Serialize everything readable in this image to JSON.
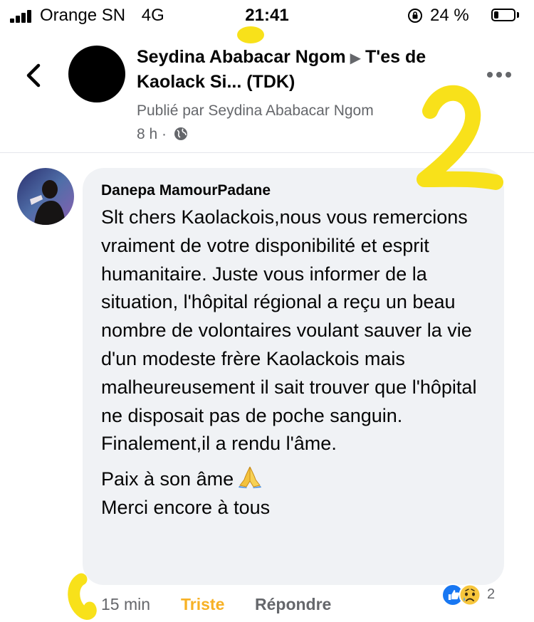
{
  "status_bar": {
    "carrier": "Orange SN",
    "network": "4G",
    "time": "21:41",
    "battery_percent": "24 %",
    "battery_level": 0.24,
    "icons": [
      "signal-icon",
      "orientation-lock-icon",
      "battery-icon"
    ]
  },
  "header": {
    "author": "Seydina Ababacar Ngom",
    "group": "T'es de Kaolack Si... (TDK)",
    "posted_by": "Publié par Seydina Ababacar Ngom",
    "age": "8 h",
    "separator": "·",
    "icons": [
      "back-chevron-icon",
      "arrow-right-icon",
      "globe-icon",
      "more-dots-icon"
    ]
  },
  "comment": {
    "author": "Danepa MamourPadane",
    "paragraphs": [
      "Slt chers Kaolackois,nous vous remercions vraiment de votre disponibilité et esprit humanitaire. Juste vous informer de la situation, l'hôpital régional a reçu un beau nombre de volontaires voulant sauver la vie d'un modeste frère Kaolackois mais malheureusement il sait trouver que l'hôpital ne disposait pas de poche sanguin.",
      "Finalement,il a rendu l'âme.",
      "Paix à son âme",
      "Merci encore à tous"
    ],
    "emoji": "folded-hands-icon"
  },
  "actions": {
    "time": "15 min",
    "reaction": "Triste",
    "reply": "Répondre",
    "reaction_count": "2",
    "reaction_icons": [
      "like-icon",
      "sad-face-icon"
    ]
  },
  "colors": {
    "text": "#050505",
    "secondary": "#65676b",
    "bubble": "#f0f2f5",
    "sad_reaction": "#f7b125",
    "like_blue": "#1877f2",
    "highlighter": "#f8e11a"
  }
}
